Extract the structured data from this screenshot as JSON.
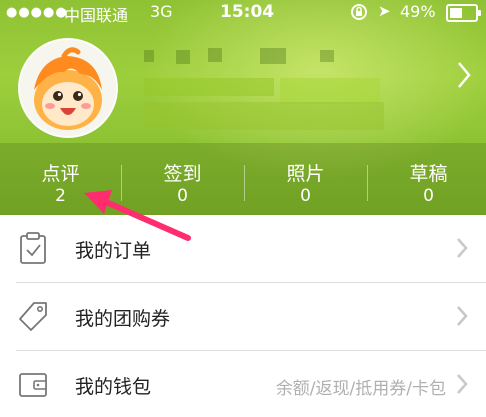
{
  "status_bar": {
    "carrier": "中国联通",
    "network": "3G",
    "time": "15:04",
    "battery": "49%",
    "battery_level_percent": 49
  },
  "profile": {
    "avatar_icon": "cartoon-avatar-icon"
  },
  "stats": [
    {
      "label": "点评",
      "count": "2"
    },
    {
      "label": "签到",
      "count": "0"
    },
    {
      "label": "照片",
      "count": "0"
    },
    {
      "label": "草稿",
      "count": "0"
    }
  ],
  "menu": [
    {
      "label": "我的订单",
      "icon": "clipboard-check-icon",
      "sub": ""
    },
    {
      "label": "我的团购券",
      "icon": "tag-icon",
      "sub": ""
    },
    {
      "label": "我的钱包",
      "icon": "wallet-icon",
      "sub": "余额/返现/抵用券/卡包"
    }
  ],
  "colors": {
    "header_green": "#9dce3c",
    "annotation_arrow": "#ff2d6e",
    "chevron": "#c7c7cc"
  }
}
